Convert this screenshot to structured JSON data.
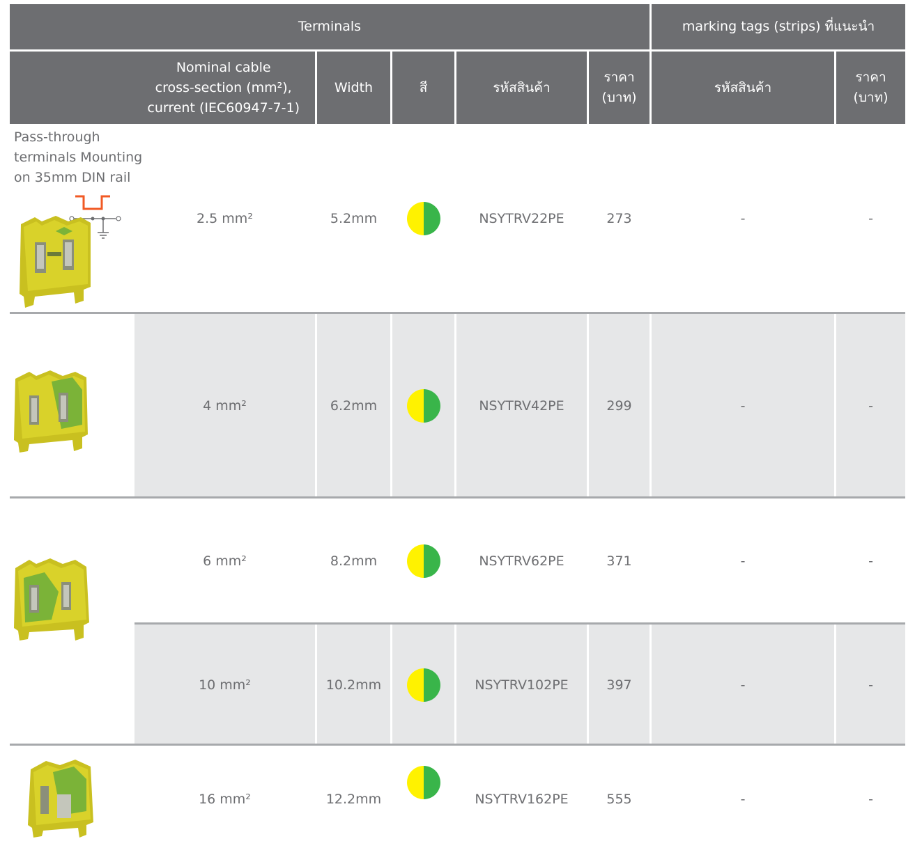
{
  "header": {
    "group_terminals": "Terminals",
    "group_tags": "marking tags (strips) ที่แนะนำ",
    "col_nominal_1": "Nominal cable",
    "col_nominal_2": "cross-section (mm²),",
    "col_nominal_3": "current (IEC60947-7-1)",
    "col_width": "Width",
    "col_color": "สี",
    "col_code": "รหัสสินค้า",
    "col_price_1": "ราคา",
    "col_price_2": "(บาท)",
    "col_tag_code": "รหัสสินค้า",
    "col_tag_price_1": "ราคา",
    "col_tag_price_2": "(บาท)"
  },
  "description": {
    "line1": "Pass-through",
    "line2": "terminals Mounting",
    "line3": "on 35mm DIN rail"
  },
  "colors": {
    "header_bg": "#6d6e71",
    "stripe_bg": "#e6e7e8",
    "terminal_yellow": "#fff200",
    "terminal_green": "#39b54a",
    "symbol_orange": "#f15a24"
  },
  "rows": [
    {
      "section": "2.5 mm²",
      "width": "5.2mm",
      "color": "yellow-green-icon",
      "code": "NSYTRV22PE",
      "price": "273",
      "tag_code": "-",
      "tag_price": "-"
    },
    {
      "section": "4 mm²",
      "width": "6.2mm",
      "color": "yellow-green-icon",
      "code": "NSYTRV42PE",
      "price": "299",
      "tag_code": "-",
      "tag_price": "-"
    },
    {
      "section": "6 mm²",
      "width": "8.2mm",
      "color": "yellow-green-icon",
      "code": "NSYTRV62PE",
      "price": "371",
      "tag_code": "-",
      "tag_price": "-"
    },
    {
      "section": "10 mm²",
      "width": "10.2mm",
      "color": "yellow-green-icon",
      "code": "NSYTRV102PE",
      "price": "397",
      "tag_code": "-",
      "tag_price": "-"
    },
    {
      "section": "16 mm²",
      "width": "12.2mm",
      "color": "yellow-green-icon",
      "code": "NSYTRV162PE",
      "price": "555",
      "tag_code": "-",
      "tag_price": "-"
    }
  ]
}
